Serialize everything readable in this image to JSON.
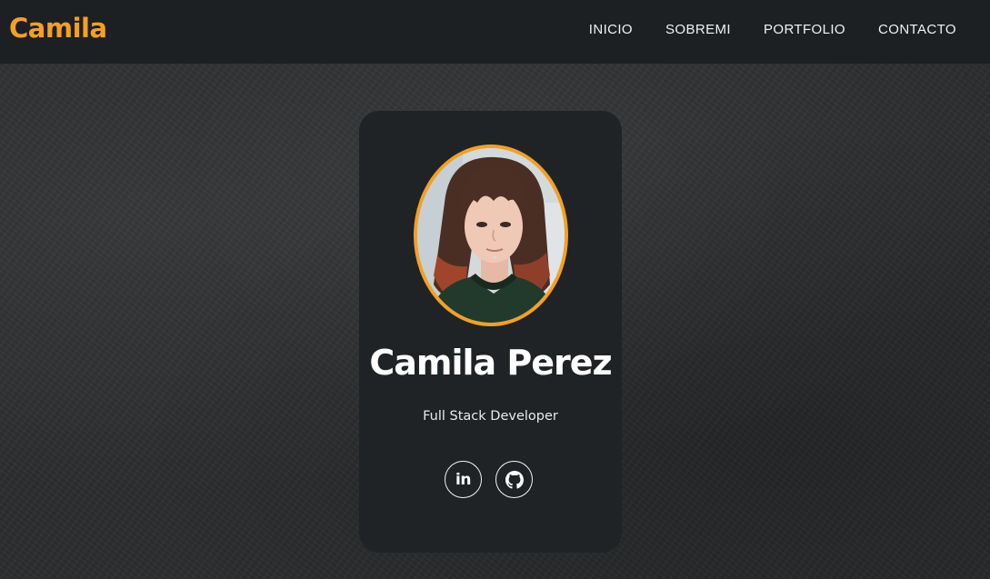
{
  "header": {
    "brand": "Camila",
    "nav": [
      "INICIO",
      "SOBREMI",
      "PORTFOLIO",
      "CONTACTO"
    ]
  },
  "profile": {
    "name": "Camila Perez",
    "role": "Full Stack Developer",
    "socials": [
      {
        "icon": "linkedin-icon",
        "label": "in"
      },
      {
        "icon": "github-icon"
      }
    ]
  },
  "colors": {
    "accent": "#f4a024",
    "nav_bg": "#1d2023",
    "card_bg": "#202325",
    "page_bg": "#2b2d2e",
    "text": "#ffffff"
  }
}
